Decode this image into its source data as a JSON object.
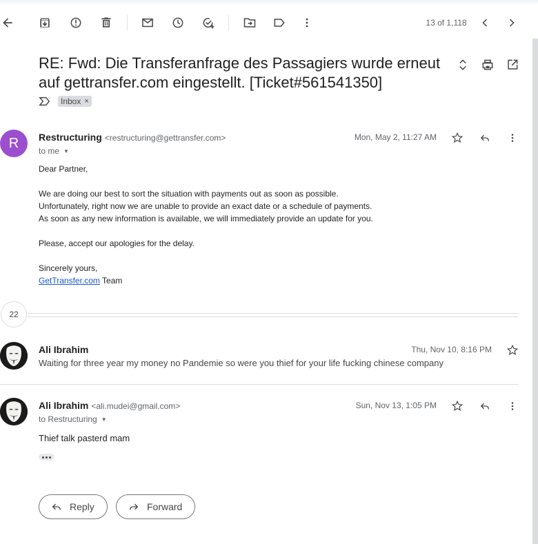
{
  "toolbar": {
    "counter": "13 of 1,118",
    "icons": [
      "back-arrow-icon",
      "archive-icon",
      "report-spam-icon",
      "delete-icon",
      "mark-unread-icon",
      "snooze-icon",
      "add-task-icon",
      "move-to-icon",
      "label-icon",
      "more-vert-icon",
      "older-icon",
      "newer-icon"
    ]
  },
  "subject": {
    "title": "RE: Fwd: Die Transferanfrage des Passagiers wurde erneut auf gettransfer.com eingestellt. [Ticket#561541350]",
    "label_chip": "Inbox",
    "label_remove": "×"
  },
  "message1": {
    "avatar_letter": "R",
    "avatar_color": "#9b4fcf",
    "sender": "Restructuring",
    "email": "<restructuring@gettransfer.com>",
    "date": "Mon, May 2, 11:27 AM",
    "to": "to me",
    "body": {
      "greeting": "Dear Partner,",
      "line1": "We are doing our best to sort the situation with payments out as soon as possible.",
      "line2": "Unfortunately, right now we are unable to provide an exact date or a schedule of payments.",
      "line3": "As soon as any new information is available, we will immediately provide an update for you.",
      "line4": "Please, accept our apologies for the delay.",
      "sign1": "Sincerely yours,",
      "sign_link": "GetTransfer.com",
      "sign_team": " Team"
    }
  },
  "collapsed": {
    "count": "22"
  },
  "message2": {
    "sender": "Ali Ibrahim",
    "date": "Thu, Nov 10, 8:16 PM",
    "snippet": "Waiting for three year my money no Pandemie so were you thief for your life fucking chinese company"
  },
  "message3": {
    "sender": "Ali Ibrahim",
    "email": "<ali.mudei@gmail.com>",
    "date": "Sun, Nov 13, 1:05 PM",
    "to": "to Restructuring",
    "body": "Thief talk pasterd mam"
  },
  "actions": {
    "reply": "Reply",
    "forward": "Forward"
  },
  "colors": {
    "link": "#1a57c9",
    "chip_bg": "#dadce0"
  }
}
